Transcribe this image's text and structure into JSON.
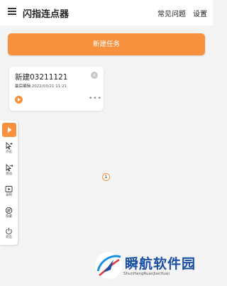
{
  "header": {
    "title": "闪指连点器",
    "faq_label": "常见问题",
    "settings_label": "设置"
  },
  "main": {
    "new_task_label": "新建任务"
  },
  "task_card": {
    "name": "新建03211121",
    "meta_label": "最后编辑",
    "meta_value": "2022/03/21 11:21",
    "more": "•••",
    "close": "×"
  },
  "toolbar": {
    "items": [
      {
        "label": "点击",
        "icon": "add-tap-icon"
      },
      {
        "label": "滑动",
        "icon": "swipe-icon"
      },
      {
        "label": "录制",
        "icon": "record-icon"
      },
      {
        "label": "隐藏",
        "icon": "hide-icon"
      },
      {
        "label": "退出",
        "icon": "power-icon"
      }
    ]
  },
  "canvas": {
    "point_number": "1"
  },
  "watermark": {
    "text": "瞬航软件园",
    "subtext": "ShunHangRuanJianYuan"
  },
  "colors": {
    "accent": "#f7913d",
    "background": "#f4f4f4",
    "watermark": "#1a4fa3"
  }
}
